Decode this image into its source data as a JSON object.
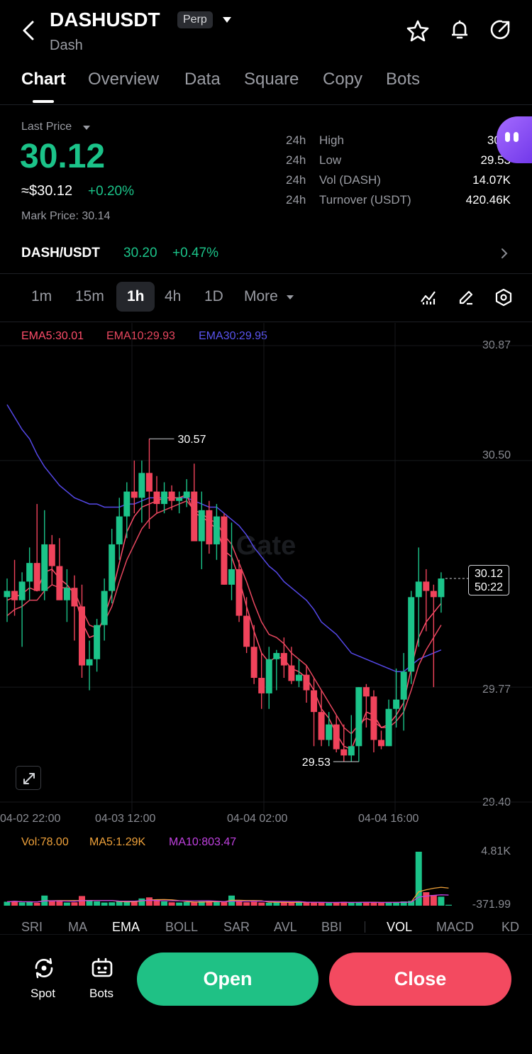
{
  "header": {
    "symbol": "DASHUSDT",
    "badge": "Perp",
    "subtitle": "Dash"
  },
  "tabs": [
    "Chart",
    "Overview",
    "Data",
    "Square",
    "Copy",
    "Bots"
  ],
  "price": {
    "last_price_label": "Last Price",
    "last_price": "30.12",
    "usd_equiv": "≈$30.12",
    "change": "+0.20%",
    "mark_price": "Mark Price: 30.14"
  },
  "stats": [
    {
      "period": "24h",
      "label": "High",
      "value": "30.5"
    },
    {
      "period": "24h",
      "label": "Low",
      "value": "29.53"
    },
    {
      "period": "24h",
      "label": "Vol (DASH)",
      "value": "14.07K"
    },
    {
      "period": "24h",
      "label": "Turnover (USDT)",
      "value": "420.46K"
    }
  ],
  "spot_pair": {
    "pair": "DASH/USDT",
    "price": "30.20",
    "change": "+0.47%"
  },
  "timeframes": [
    "1m",
    "15m",
    "1h",
    "4h",
    "1D",
    "More"
  ],
  "selected_timeframe": "1h",
  "ema": {
    "ema5": "EMA5:30.01",
    "ema10": "EMA10:29.93",
    "ema30": "EMA30:29.95"
  },
  "y_axis": [
    "30.87",
    "30.50",
    "29.77",
    "29.40"
  ],
  "x_axis": [
    "04-02 22:00",
    "04-03 12:00",
    "04-04 02:00",
    "04-04 16:00"
  ],
  "annotations": {
    "high": "30.57",
    "low": "29.53",
    "current_price": "30.12",
    "countdown": "50:22"
  },
  "watermark": "Gate",
  "volume": {
    "vol": "Vol:78.00",
    "ma5": "MA5:1.29K",
    "ma10": "MA10:803.47",
    "axis_top": "4.81K",
    "axis_bottom": "-371.99"
  },
  "indicators": [
    "SRI",
    "MA",
    "EMA",
    "BOLL",
    "SAR",
    "AVL",
    "BBI",
    "VOL",
    "MACD",
    "KD"
  ],
  "bottom_bar": {
    "spot": "Spot",
    "bots": "Bots",
    "open": "Open",
    "close": "Close"
  },
  "colors": {
    "up": "#1bc389",
    "down": "#f0435b",
    "ema5": "#ff4d6a",
    "ema10": "#e8475f",
    "ema30": "#5548e8",
    "vol_ma5": "#f0a23a",
    "vol_ma10": "#c041e0",
    "open_button": "#1fc185",
    "close_button": "#f34a60"
  },
  "candles": [
    {
      "o": 30.06,
      "h": 30.12,
      "l": 29.98,
      "c": 30.08
    },
    {
      "o": 30.08,
      "h": 30.18,
      "l": 30.0,
      "c": 30.05
    },
    {
      "o": 30.05,
      "h": 30.14,
      "l": 29.9,
      "c": 30.11
    },
    {
      "o": 30.11,
      "h": 30.22,
      "l": 30.05,
      "c": 30.17
    },
    {
      "o": 30.17,
      "h": 30.36,
      "l": 30.08,
      "c": 30.08
    },
    {
      "o": 30.08,
      "h": 30.34,
      "l": 30.05,
      "c": 30.23
    },
    {
      "o": 30.23,
      "h": 30.26,
      "l": 30.1,
      "c": 30.16
    },
    {
      "o": 30.16,
      "h": 30.25,
      "l": 30.1,
      "c": 30.05
    },
    {
      "o": 30.05,
      "h": 30.15,
      "l": 29.98,
      "c": 30.09
    },
    {
      "o": 30.09,
      "h": 30.13,
      "l": 29.92,
      "c": 30.03
    },
    {
      "o": 30.03,
      "h": 30.1,
      "l": 29.8,
      "c": 29.84
    },
    {
      "o": 29.84,
      "h": 29.92,
      "l": 29.76,
      "c": 29.86
    },
    {
      "o": 29.86,
      "h": 29.99,
      "l": 29.82,
      "c": 29.97
    },
    {
      "o": 29.97,
      "h": 30.12,
      "l": 29.92,
      "c": 30.08
    },
    {
      "o": 30.08,
      "h": 30.28,
      "l": 30.04,
      "c": 30.23
    },
    {
      "o": 30.23,
      "h": 30.38,
      "l": 30.18,
      "c": 30.32
    },
    {
      "o": 30.32,
      "h": 30.43,
      "l": 30.25,
      "c": 30.4
    },
    {
      "o": 30.4,
      "h": 30.5,
      "l": 30.33,
      "c": 30.38
    },
    {
      "o": 30.38,
      "h": 30.5,
      "l": 30.3,
      "c": 30.46
    },
    {
      "o": 30.46,
      "h": 30.57,
      "l": 30.28,
      "c": 30.4
    },
    {
      "o": 30.4,
      "h": 30.45,
      "l": 30.33,
      "c": 30.36
    },
    {
      "o": 30.36,
      "h": 30.43,
      "l": 30.33,
      "c": 30.4
    },
    {
      "o": 30.4,
      "h": 30.42,
      "l": 30.34,
      "c": 30.37
    },
    {
      "o": 30.37,
      "h": 30.4,
      "l": 30.33,
      "c": 30.38
    },
    {
      "o": 30.38,
      "h": 30.44,
      "l": 30.35,
      "c": 30.4
    },
    {
      "o": 30.4,
      "h": 30.49,
      "l": 30.25,
      "c": 30.24
    },
    {
      "o": 30.24,
      "h": 30.4,
      "l": 30.15,
      "c": 30.34
    },
    {
      "o": 30.34,
      "h": 30.37,
      "l": 30.2,
      "c": 30.23
    },
    {
      "o": 30.23,
      "h": 30.36,
      "l": 30.18,
      "c": 30.32
    },
    {
      "o": 30.32,
      "h": 30.33,
      "l": 30.1,
      "c": 30.1
    },
    {
      "o": 30.1,
      "h": 30.3,
      "l": 30.05,
      "c": 30.15
    },
    {
      "o": 30.15,
      "h": 30.18,
      "l": 29.98,
      "c": 30.0
    },
    {
      "o": 30.0,
      "h": 30.06,
      "l": 29.88,
      "c": 29.9
    },
    {
      "o": 29.9,
      "h": 29.97,
      "l": 29.78,
      "c": 29.8
    },
    {
      "o": 29.8,
      "h": 29.88,
      "l": 29.7,
      "c": 29.75
    },
    {
      "o": 29.75,
      "h": 29.9,
      "l": 29.7,
      "c": 29.86
    },
    {
      "o": 29.86,
      "h": 29.89,
      "l": 29.76,
      "c": 29.88
    },
    {
      "o": 29.88,
      "h": 29.93,
      "l": 29.8,
      "c": 29.84
    },
    {
      "o": 29.84,
      "h": 29.9,
      "l": 29.78,
      "c": 29.79
    },
    {
      "o": 29.79,
      "h": 29.86,
      "l": 29.77,
      "c": 29.81
    },
    {
      "o": 29.81,
      "h": 29.84,
      "l": 29.72,
      "c": 29.76
    },
    {
      "o": 29.76,
      "h": 29.8,
      "l": 29.58,
      "c": 29.69
    },
    {
      "o": 29.69,
      "h": 29.76,
      "l": 29.58,
      "c": 29.6
    },
    {
      "o": 29.6,
      "h": 29.69,
      "l": 29.58,
      "c": 29.65
    },
    {
      "o": 29.65,
      "h": 29.68,
      "l": 29.56,
      "c": 29.57
    },
    {
      "o": 29.57,
      "h": 29.65,
      "l": 29.53,
      "c": 29.55
    },
    {
      "o": 29.55,
      "h": 29.68,
      "l": 29.53,
      "c": 29.58
    },
    {
      "o": 29.58,
      "h": 29.77,
      "l": 29.53,
      "c": 29.77
    },
    {
      "o": 29.77,
      "h": 29.78,
      "l": 29.64,
      "c": 29.74
    },
    {
      "o": 29.74,
      "h": 29.76,
      "l": 29.56,
      "c": 29.6
    },
    {
      "o": 29.6,
      "h": 29.63,
      "l": 29.57,
      "c": 29.58
    },
    {
      "o": 29.58,
      "h": 29.73,
      "l": 29.58,
      "c": 29.7
    },
    {
      "o": 29.7,
      "h": 29.83,
      "l": 29.64,
      "c": 29.73
    },
    {
      "o": 29.73,
      "h": 29.88,
      "l": 29.63,
      "c": 29.82
    },
    {
      "o": 29.82,
      "h": 30.08,
      "l": 29.78,
      "c": 30.06
    },
    {
      "o": 30.06,
      "h": 30.22,
      "l": 29.9,
      "c": 30.11
    },
    {
      "o": 30.11,
      "h": 30.15,
      "l": 29.95,
      "c": 30.08
    },
    {
      "o": 30.08,
      "h": 30.1,
      "l": 29.77,
      "c": 30.06
    },
    {
      "o": 30.06,
      "h": 30.14,
      "l": 30.01,
      "c": 30.12
    }
  ],
  "ema_series": {
    "ema5": [
      30.05,
      30.06,
      30.07,
      30.09,
      30.08,
      30.14,
      30.15,
      30.12,
      30.1,
      30.07,
      29.98,
      29.93,
      29.94,
      30.0,
      30.07,
      30.17,
      30.27,
      30.32,
      30.35,
      30.36,
      30.37,
      30.38,
      30.38,
      30.38,
      30.39,
      30.33,
      30.32,
      30.3,
      30.28,
      30.21,
      30.19,
      30.12,
      30.03,
      29.95,
      29.88,
      29.85,
      29.87,
      29.86,
      29.83,
      29.82,
      29.8,
      29.76,
      29.7,
      29.67,
      29.62,
      29.58,
      29.57,
      29.63,
      29.69,
      29.68,
      29.64,
      29.65,
      29.68,
      29.72,
      29.83,
      29.93,
      29.98,
      30.01,
      30.04
    ],
    "ema10": [
      30.0,
      30.02,
      30.03,
      30.05,
      30.05,
      30.08,
      30.1,
      30.09,
      30.09,
      30.08,
      30.02,
      29.97,
      29.96,
      29.98,
      30.03,
      30.11,
      30.18,
      30.23,
      30.28,
      30.31,
      30.33,
      30.34,
      30.35,
      30.36,
      30.37,
      30.34,
      30.33,
      30.31,
      30.3,
      30.26,
      30.23,
      30.17,
      30.11,
      30.04,
      29.98,
      29.94,
      29.93,
      29.91,
      29.88,
      29.86,
      29.84,
      29.8,
      29.76,
      29.72,
      29.68,
      29.64,
      29.62,
      29.65,
      29.67,
      29.66,
      29.64,
      29.64,
      29.66,
      29.69,
      29.76,
      29.84,
      29.89,
      29.93,
      29.97
    ],
    "ema30": [
      30.68,
      30.64,
      30.6,
      30.57,
      30.52,
      30.48,
      30.45,
      30.42,
      30.4,
      30.38,
      30.37,
      30.36,
      30.36,
      30.35,
      30.35,
      30.35,
      30.36,
      30.36,
      30.37,
      30.38,
      30.38,
      30.38,
      30.38,
      30.38,
      30.38,
      30.37,
      30.36,
      30.35,
      30.35,
      30.33,
      30.31,
      30.29,
      30.26,
      30.22,
      30.19,
      30.16,
      30.14,
      30.11,
      30.09,
      30.07,
      30.05,
      30.02,
      29.98,
      29.96,
      29.94,
      29.91,
      29.88,
      29.87,
      29.86,
      29.85,
      29.84,
      29.83,
      29.82,
      29.82,
      29.84,
      29.86,
      29.87,
      29.88,
      29.89
    ]
  },
  "volumes": [
    350,
    420,
    300,
    320,
    250,
    900,
    420,
    380,
    280,
    300,
    860,
    500,
    380,
    280,
    300,
    420,
    330,
    400,
    640,
    740,
    560,
    380,
    300,
    280,
    320,
    300,
    380,
    420,
    350,
    340,
    900,
    380,
    300,
    350,
    280,
    260,
    320,
    300,
    280,
    350,
    300,
    280,
    260,
    240,
    300,
    350,
    280,
    300,
    320,
    290,
    250,
    300,
    280,
    380,
    420,
    4810,
    1200,
    950,
    800,
    78
  ]
}
